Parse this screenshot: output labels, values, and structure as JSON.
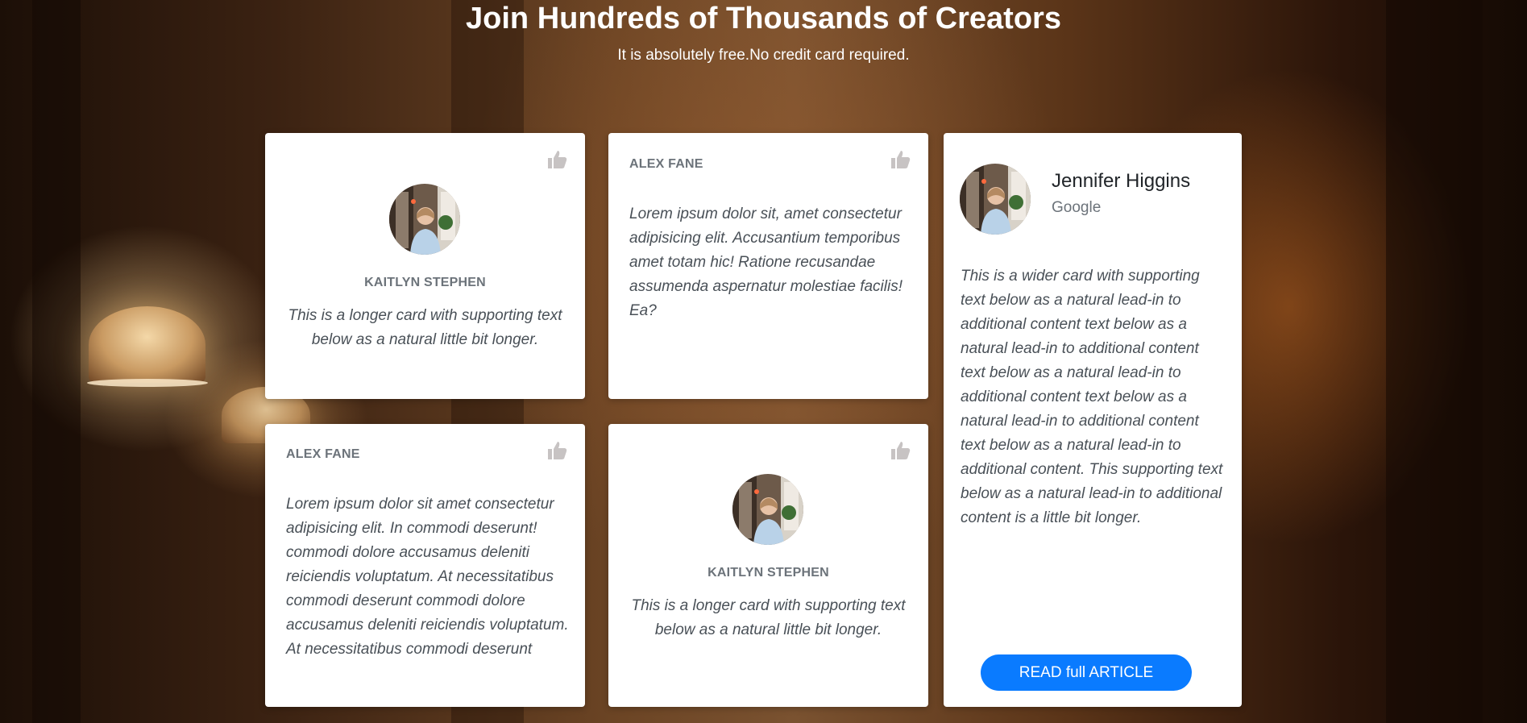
{
  "hero": {
    "title": "Join Hundreds of Thousands of Creators",
    "subtitle": "It is absolutely free.No credit card required."
  },
  "cards": {
    "card1": {
      "name": "KAITLYN STEPHEN",
      "text": "This is a longer card with supporting text below as a natural little bit longer."
    },
    "card2": {
      "name": "ALEX FANE",
      "text": "Lorem ipsum dolor sit, amet consectetur adipisicing elit. Accusantium temporibus amet totam hic! Ratione recusandae assumenda aspernatur molestiae facilis! Ea?"
    },
    "card3": {
      "name": "Jennifer Higgins",
      "company": "Google",
      "text": "This is a wider card with supporting text below as a natural lead-in to additional content text below as a natural lead-in to additional content text below as a natural lead-in to additional content text below as a natural lead-in to additional content text below as a natural lead-in to additional content. This supporting text below as a natural lead-in to additional content is a little bit longer.",
      "button_label": "READ full ARTICLE"
    },
    "card4": {
      "name": "ALEX FANE",
      "text": "Lorem ipsum dolor sit amet consectetur adipisicing elit. In commodi deserunt! commodi dolore accusamus deleniti reiciendis voluptatum. At necessitatibus commodi deserunt commodi dolore accusamus deleniti reiciendis voluptatum. At necessitatibus commodi deserunt"
    },
    "card5": {
      "name": "KAITLYN STEPHEN",
      "text": "This is a longer card with supporting text below as a natural little bit longer."
    }
  },
  "colors": {
    "accent": "#0a7bff",
    "muted_text": "#6c737a",
    "body_text": "#495057",
    "thumb_icon": "#c7c3c3"
  },
  "icons": {
    "like": "thumbs-up-icon",
    "avatar": "person-photo"
  }
}
